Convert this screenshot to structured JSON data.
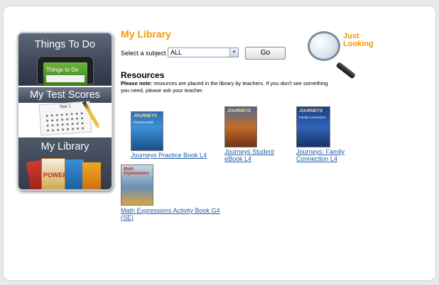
{
  "nav": {
    "things_to_do": "Things To Do",
    "things_to_do_screen": "Things to Do",
    "my_test_scores": "My Test Scores",
    "test_paper_title": "Test 1",
    "my_library": "My Library",
    "book_cover_text": "POWER"
  },
  "main": {
    "heading": "My Library",
    "subject_label": "Select a subject",
    "subject_selected": "ALL",
    "go_label": "Go",
    "just_looking_line1": "Just",
    "just_looking_line2": "Looking",
    "resources_title": "Resources",
    "note_bold": "Please note:",
    "note_text": " resources are placed in the library by teachers. If you don't see something you need, please ask your teacher."
  },
  "books": [
    {
      "title": "Journeys Practice Book L4",
      "cover_title": "JOURNEYS",
      "cover_sub": "Practice Book"
    },
    {
      "title": "Journeys Student eBook L4",
      "cover_title": "JOURNEYS",
      "cover_sub": ""
    },
    {
      "title": "Journeys: Family Connection L4",
      "cover_title": "JOURNEYS",
      "cover_sub": "Family Connection"
    },
    {
      "title": "Math Expressions Activity Book G4 (SE)",
      "cover_title": "Math Expressions",
      "cover_sub": ""
    }
  ],
  "colors": {
    "accent": "#f29a00",
    "link": "#1f5fa8",
    "nav_bg": "#3f4a5c"
  }
}
